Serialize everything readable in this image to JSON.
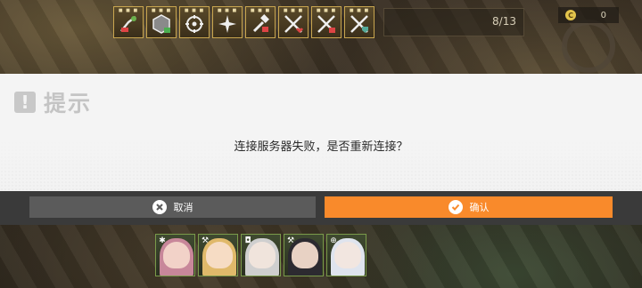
{
  "hud": {
    "skills": [
      {
        "name": "sprout-skill-icon",
        "level": "■ ■ ■"
      },
      {
        "name": "hexagon-skill-icon",
        "level": "■ ■ ■"
      },
      {
        "name": "target-skill-icon",
        "level": "■ ■ ■"
      },
      {
        "name": "sparkle-skill-icon",
        "level": "■ ■ ■"
      },
      {
        "name": "hammer-skill-icon",
        "level": "■ ■ ■"
      },
      {
        "name": "crossed-swords-heart-icon",
        "level": "■ ■ ■"
      },
      {
        "name": "crossed-swords-icon",
        "level": "■ ■ ■"
      },
      {
        "name": "crossed-swords-shield-icon",
        "level": "■ ■ ■"
      }
    ],
    "stage_counter": "8/13",
    "coin_symbol": "C",
    "coin_value": "0"
  },
  "dialog": {
    "badge": "!",
    "title": "提示",
    "message": "连接服务器失败，是否重新连接？"
  },
  "buttons": {
    "cancel_label": "取消",
    "confirm_label": "确认"
  },
  "team": {
    "members": [
      {
        "name": "pink-hair-operator",
        "class_glyph": "✱",
        "hair": "#c8879a",
        "face": "#f2d2c8"
      },
      {
        "name": "blonde-hair-operator",
        "class_glyph": "⚒",
        "hair": "#e0b96a",
        "face": "#f6dcc4"
      },
      {
        "name": "silver-hair-operator",
        "class_glyph": "◘",
        "hair": "#cfcfcf",
        "face": "#f0e4dc"
      },
      {
        "name": "dark-hair-operator",
        "class_glyph": "⚒",
        "hair": "#2c2a30",
        "face": "#e8d2c4"
      },
      {
        "name": "white-hair-operator",
        "class_glyph": "⊕",
        "hair": "#dfe4ee",
        "face": "#f2e6e0"
      }
    ]
  },
  "colors": {
    "confirm": "#f98a2b",
    "cancel": "#5b5b5b",
    "strip": "#3a3a3a",
    "skill_border": "#c9a650"
  }
}
